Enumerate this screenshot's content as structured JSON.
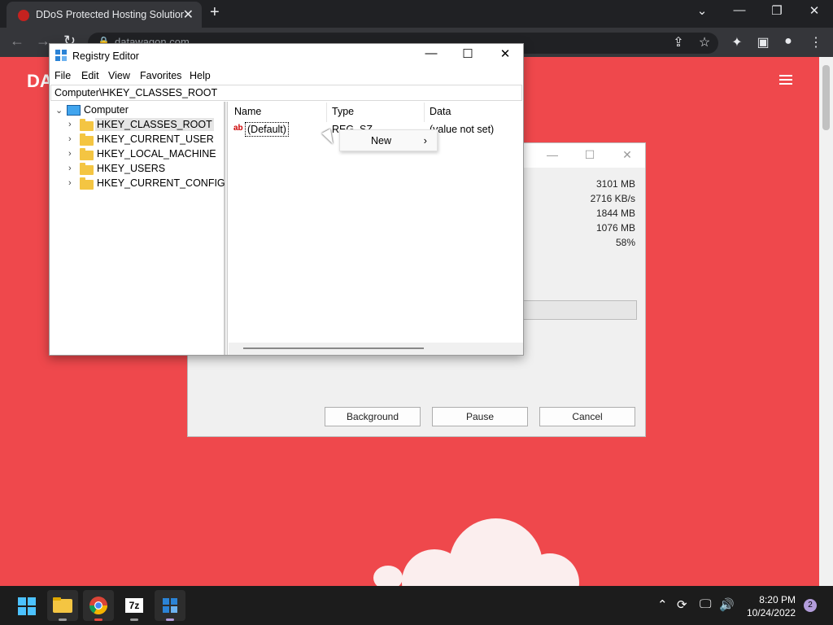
{
  "browser": {
    "tab_title": "DDoS Protected Hosting Solution",
    "tab_close": "✕",
    "new_tab": "+",
    "url": "datawagon.com",
    "window_controls": {
      "tabsearch": "⌄",
      "minimize": "—",
      "restore": "❐",
      "close": "✕"
    },
    "icons": [
      "share-icon",
      "star-icon",
      "extensions-icon",
      "sidepanel-icon",
      "profile-icon",
      "menu-icon"
    ]
  },
  "site": {
    "logo_text": "DA"
  },
  "background_dialog": {
    "stats": [
      "3101 MB",
      "2716 KB/s",
      "1844 MB",
      "1076 MB",
      "58%"
    ],
    "buttons": {
      "background": "Background",
      "pause": "Pause",
      "cancel": "Cancel"
    }
  },
  "regedit": {
    "title": "Registry Editor",
    "window_controls": {
      "minimize": "—",
      "maximize": "☐",
      "close": "✕"
    },
    "menu": [
      "File",
      "Edit",
      "View",
      "Favorites",
      "Help"
    ],
    "address": "Computer\\HKEY_CLASSES_ROOT",
    "tree": {
      "root": "Computer",
      "items": [
        "HKEY_CLASSES_ROOT",
        "HKEY_CURRENT_USER",
        "HKEY_LOCAL_MACHINE",
        "HKEY_USERS",
        "HKEY_CURRENT_CONFIG"
      ],
      "selected": "HKEY_CLASSES_ROOT"
    },
    "list": {
      "columns": [
        "Name",
        "Type",
        "Data"
      ],
      "rows": [
        {
          "name": "(Default)",
          "type": "REG_SZ",
          "data": "(value not set)"
        }
      ]
    },
    "context_menu": {
      "item": "New",
      "arrow": "›"
    }
  },
  "taskbar": {
    "apps": [
      "start-icon",
      "file-explorer-icon",
      "chrome-icon",
      "7zip-icon",
      "regedit-icon"
    ],
    "app_7z_label": "7z",
    "time": "8:20 PM",
    "date": "10/24/2022",
    "notification_count": "2"
  },
  "colors": {
    "site_bg": "#ef484c",
    "chrome_dark": "#202124",
    "taskbar": "#1c1c1c"
  }
}
